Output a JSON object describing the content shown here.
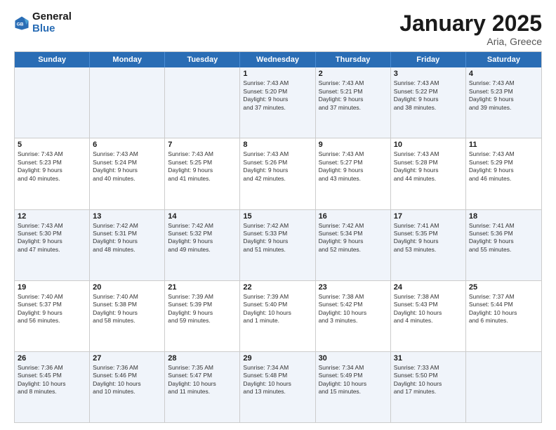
{
  "logo": {
    "line1": "General",
    "line2": "Blue"
  },
  "title": "January 2025",
  "subtitle": "Aria, Greece",
  "days": [
    "Sunday",
    "Monday",
    "Tuesday",
    "Wednesday",
    "Thursday",
    "Friday",
    "Saturday"
  ],
  "rows": [
    [
      {
        "day": "",
        "lines": []
      },
      {
        "day": "",
        "lines": []
      },
      {
        "day": "",
        "lines": []
      },
      {
        "day": "1",
        "lines": [
          "Sunrise: 7:43 AM",
          "Sunset: 5:20 PM",
          "Daylight: 9 hours",
          "and 37 minutes."
        ]
      },
      {
        "day": "2",
        "lines": [
          "Sunrise: 7:43 AM",
          "Sunset: 5:21 PM",
          "Daylight: 9 hours",
          "and 37 minutes."
        ]
      },
      {
        "day": "3",
        "lines": [
          "Sunrise: 7:43 AM",
          "Sunset: 5:22 PM",
          "Daylight: 9 hours",
          "and 38 minutes."
        ]
      },
      {
        "day": "4",
        "lines": [
          "Sunrise: 7:43 AM",
          "Sunset: 5:23 PM",
          "Daylight: 9 hours",
          "and 39 minutes."
        ]
      }
    ],
    [
      {
        "day": "5",
        "lines": [
          "Sunrise: 7:43 AM",
          "Sunset: 5:23 PM",
          "Daylight: 9 hours",
          "and 40 minutes."
        ]
      },
      {
        "day": "6",
        "lines": [
          "Sunrise: 7:43 AM",
          "Sunset: 5:24 PM",
          "Daylight: 9 hours",
          "and 40 minutes."
        ]
      },
      {
        "day": "7",
        "lines": [
          "Sunrise: 7:43 AM",
          "Sunset: 5:25 PM",
          "Daylight: 9 hours",
          "and 41 minutes."
        ]
      },
      {
        "day": "8",
        "lines": [
          "Sunrise: 7:43 AM",
          "Sunset: 5:26 PM",
          "Daylight: 9 hours",
          "and 42 minutes."
        ]
      },
      {
        "day": "9",
        "lines": [
          "Sunrise: 7:43 AM",
          "Sunset: 5:27 PM",
          "Daylight: 9 hours",
          "and 43 minutes."
        ]
      },
      {
        "day": "10",
        "lines": [
          "Sunrise: 7:43 AM",
          "Sunset: 5:28 PM",
          "Daylight: 9 hours",
          "and 44 minutes."
        ]
      },
      {
        "day": "11",
        "lines": [
          "Sunrise: 7:43 AM",
          "Sunset: 5:29 PM",
          "Daylight: 9 hours",
          "and 46 minutes."
        ]
      }
    ],
    [
      {
        "day": "12",
        "lines": [
          "Sunrise: 7:43 AM",
          "Sunset: 5:30 PM",
          "Daylight: 9 hours",
          "and 47 minutes."
        ]
      },
      {
        "day": "13",
        "lines": [
          "Sunrise: 7:42 AM",
          "Sunset: 5:31 PM",
          "Daylight: 9 hours",
          "and 48 minutes."
        ]
      },
      {
        "day": "14",
        "lines": [
          "Sunrise: 7:42 AM",
          "Sunset: 5:32 PM",
          "Daylight: 9 hours",
          "and 49 minutes."
        ]
      },
      {
        "day": "15",
        "lines": [
          "Sunrise: 7:42 AM",
          "Sunset: 5:33 PM",
          "Daylight: 9 hours",
          "and 51 minutes."
        ]
      },
      {
        "day": "16",
        "lines": [
          "Sunrise: 7:42 AM",
          "Sunset: 5:34 PM",
          "Daylight: 9 hours",
          "and 52 minutes."
        ]
      },
      {
        "day": "17",
        "lines": [
          "Sunrise: 7:41 AM",
          "Sunset: 5:35 PM",
          "Daylight: 9 hours",
          "and 53 minutes."
        ]
      },
      {
        "day": "18",
        "lines": [
          "Sunrise: 7:41 AM",
          "Sunset: 5:36 PM",
          "Daylight: 9 hours",
          "and 55 minutes."
        ]
      }
    ],
    [
      {
        "day": "19",
        "lines": [
          "Sunrise: 7:40 AM",
          "Sunset: 5:37 PM",
          "Daylight: 9 hours",
          "and 56 minutes."
        ]
      },
      {
        "day": "20",
        "lines": [
          "Sunrise: 7:40 AM",
          "Sunset: 5:38 PM",
          "Daylight: 9 hours",
          "and 58 minutes."
        ]
      },
      {
        "day": "21",
        "lines": [
          "Sunrise: 7:39 AM",
          "Sunset: 5:39 PM",
          "Daylight: 9 hours",
          "and 59 minutes."
        ]
      },
      {
        "day": "22",
        "lines": [
          "Sunrise: 7:39 AM",
          "Sunset: 5:40 PM",
          "Daylight: 10 hours",
          "and 1 minute."
        ]
      },
      {
        "day": "23",
        "lines": [
          "Sunrise: 7:38 AM",
          "Sunset: 5:42 PM",
          "Daylight: 10 hours",
          "and 3 minutes."
        ]
      },
      {
        "day": "24",
        "lines": [
          "Sunrise: 7:38 AM",
          "Sunset: 5:43 PM",
          "Daylight: 10 hours",
          "and 4 minutes."
        ]
      },
      {
        "day": "25",
        "lines": [
          "Sunrise: 7:37 AM",
          "Sunset: 5:44 PM",
          "Daylight: 10 hours",
          "and 6 minutes."
        ]
      }
    ],
    [
      {
        "day": "26",
        "lines": [
          "Sunrise: 7:36 AM",
          "Sunset: 5:45 PM",
          "Daylight: 10 hours",
          "and 8 minutes."
        ]
      },
      {
        "day": "27",
        "lines": [
          "Sunrise: 7:36 AM",
          "Sunset: 5:46 PM",
          "Daylight: 10 hours",
          "and 10 minutes."
        ]
      },
      {
        "day": "28",
        "lines": [
          "Sunrise: 7:35 AM",
          "Sunset: 5:47 PM",
          "Daylight: 10 hours",
          "and 11 minutes."
        ]
      },
      {
        "day": "29",
        "lines": [
          "Sunrise: 7:34 AM",
          "Sunset: 5:48 PM",
          "Daylight: 10 hours",
          "and 13 minutes."
        ]
      },
      {
        "day": "30",
        "lines": [
          "Sunrise: 7:34 AM",
          "Sunset: 5:49 PM",
          "Daylight: 10 hours",
          "and 15 minutes."
        ]
      },
      {
        "day": "31",
        "lines": [
          "Sunrise: 7:33 AM",
          "Sunset: 5:50 PM",
          "Daylight: 10 hours",
          "and 17 minutes."
        ]
      },
      {
        "day": "",
        "lines": []
      }
    ]
  ],
  "alt_rows": [
    0,
    2,
    4
  ]
}
